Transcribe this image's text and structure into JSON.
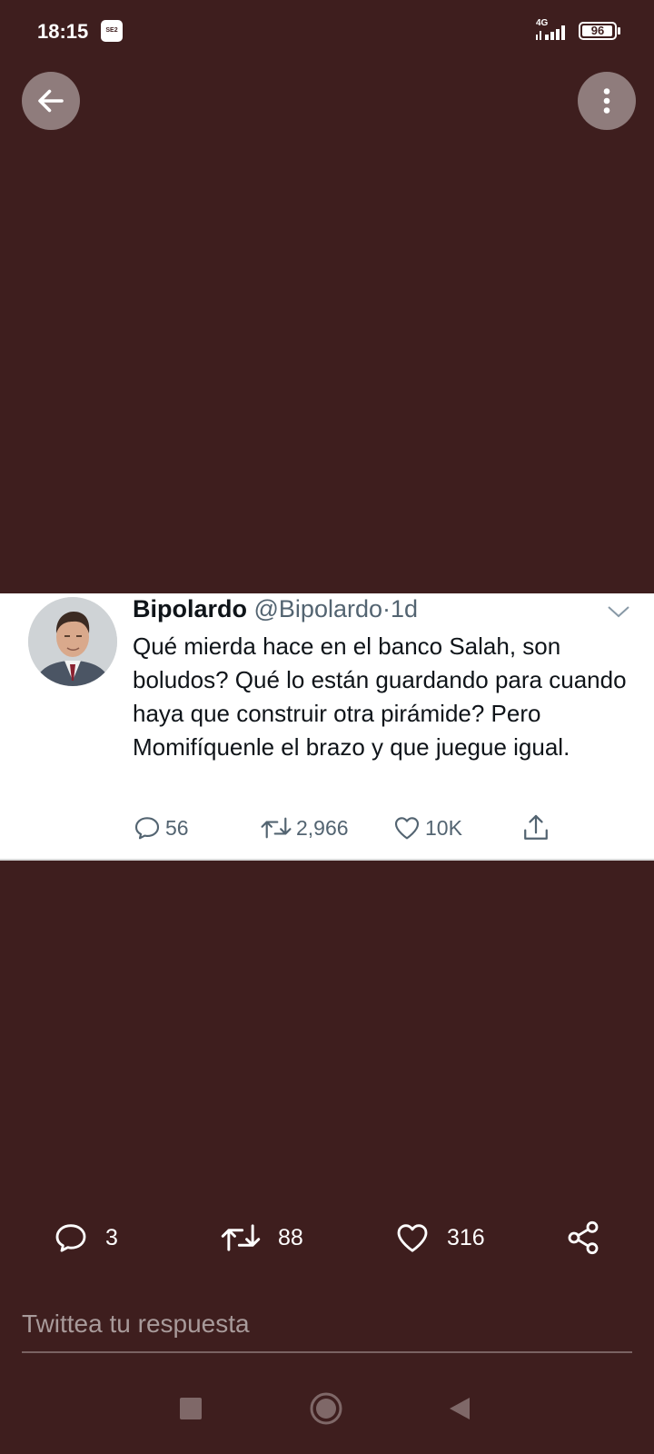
{
  "status_bar": {
    "time": "18:15",
    "carrier_badge": "SE2",
    "network": "4G",
    "battery_percent": 96,
    "battery_label": "96"
  },
  "top_bar": {
    "back_icon": "arrow-left-icon",
    "more_icon": "more-vertical-icon"
  },
  "tweet": {
    "author_name": "Bipolardo",
    "author_handle": "@Bipolardo",
    "separator": "·",
    "time_ago": "1d",
    "text": "Qué mierda hace en el banco Salah, son boludos? Qué lo están guardando para cuando haya que construir otra pirámide? Pero Momifíquenle el brazo y que juegue igual.",
    "replies": "56",
    "retweets": "2,966",
    "likes": "10K"
  },
  "actions": {
    "replies": "3",
    "retweets": "88",
    "likes": "316"
  },
  "reply": {
    "placeholder": "Twittea tu respuesta"
  },
  "nav": {
    "recents_icon": "square-icon",
    "home_icon": "circle-icon",
    "back_icon": "triangle-back-icon"
  },
  "colors": {
    "background": "#3e1e1e",
    "card": "#ffffff",
    "text_primary": "#0f1419",
    "text_secondary": "#536471"
  }
}
